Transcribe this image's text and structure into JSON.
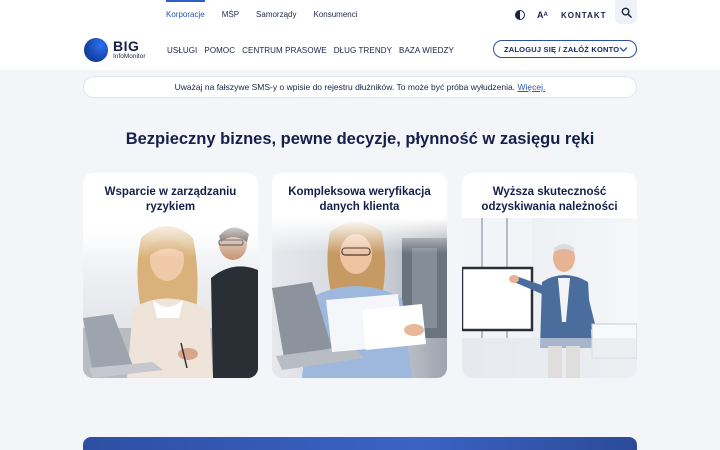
{
  "segments": [
    {
      "label": "Korporacje",
      "active": true
    },
    {
      "label": "MŚP",
      "active": false
    },
    {
      "label": "Samorządy",
      "active": false
    },
    {
      "label": "Konsumenci",
      "active": false
    }
  ],
  "utility": {
    "font_size_label": "A",
    "font_size_small": "A",
    "contact_label": "KONTAKT"
  },
  "logo": {
    "big": "BIG",
    "sub": "InfoMonitor"
  },
  "nav": {
    "items": [
      {
        "label": "USŁUGI"
      },
      {
        "label": "POMOC"
      },
      {
        "label": "CENTRUM PRASOWE"
      },
      {
        "label": "DŁUG TRENDY"
      },
      {
        "label": "BAZA WIEDZY"
      }
    ],
    "login_label": "ZALOGUJ SIĘ / ZAŁÓŻ KONTO"
  },
  "alert": {
    "text": "Uważaj na fałszywe SMS-y o wpisie do rejestru dłużników. To może być próba wyłudzenia. ",
    "link": "Więcej."
  },
  "headline": "Bezpieczny biznes, pewne decyzje, płynność w zasięgu ręki",
  "cards": [
    {
      "title_line1": "Wsparcie w zarządzaniu",
      "title_line2": "ryzykiem"
    },
    {
      "title_line1": "Kompleksowa weryfikacja",
      "title_line2": "danych klienta"
    },
    {
      "title_line1": "Wyższa skuteczność",
      "title_line2": "odzyskiwania należności"
    }
  ],
  "colors": {
    "accent": "#2d5fc9",
    "navy": "#15204a",
    "background": "#f3f5f9",
    "banner": "#3b63c4"
  },
  "icons": {
    "contrast": "contrast-icon",
    "search": "search-icon",
    "chevron": "chevron-down-icon"
  }
}
